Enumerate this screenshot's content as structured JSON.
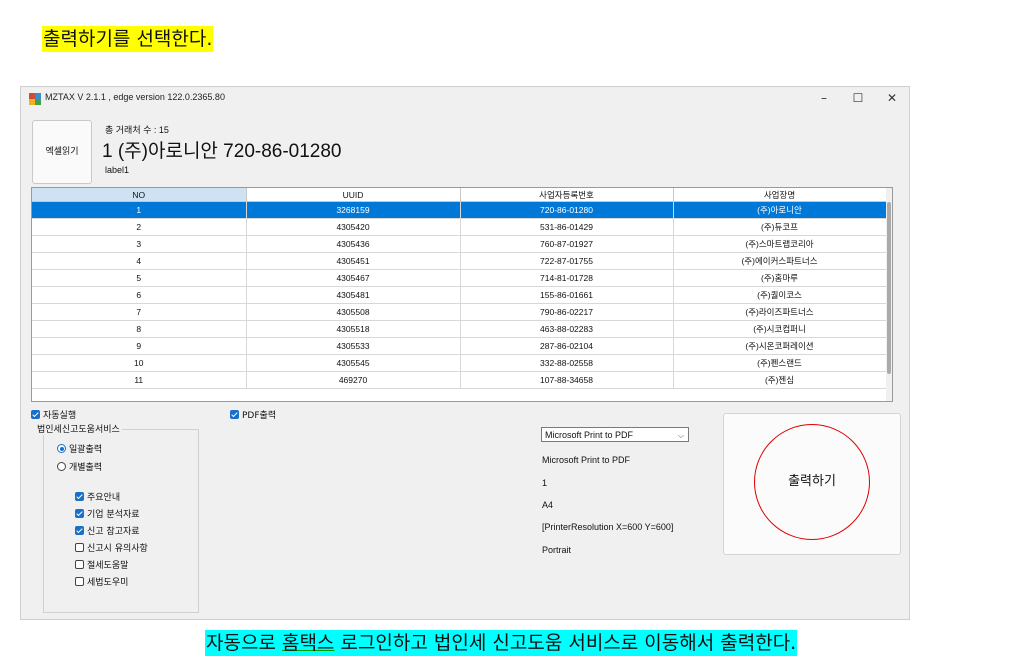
{
  "captions": {
    "top": "출력하기를 선택한다.",
    "bottom_before": "자동으로 ",
    "bottom_underlined": "홈택스",
    "bottom_after": " 로그인하고 법인세 신고도움 서비스로 이동해서 출력한다."
  },
  "window": {
    "title": "MZTAX V 2.1.1 , edge version 122.0.2365.80",
    "minimize": "–",
    "maximize": "☐",
    "close": "✕"
  },
  "header": {
    "excel_button": "엑셀읽기",
    "total_count": "총 거래처 수 : 15",
    "current_company": "1 (주)아로니안 720-86-01280",
    "label1": "label1"
  },
  "grid": {
    "columns": [
      "NO",
      "UUID",
      "사업자등록번호",
      "사업장명"
    ],
    "rows": [
      [
        "1",
        "3268159",
        "720-86-01280",
        "(주)아로니안"
      ],
      [
        "2",
        "4305420",
        "531-86-01429",
        "(주)듀코프"
      ],
      [
        "3",
        "4305436",
        "760-87-01927",
        "(주)스마트랩코리아"
      ],
      [
        "4",
        "4305451",
        "722-87-01755",
        "(주)에이커스파트너스"
      ],
      [
        "5",
        "4305467",
        "714-81-01728",
        "(주)홈마루"
      ],
      [
        "6",
        "4305481",
        "155-86-01661",
        "(주)퀄이코스"
      ],
      [
        "7",
        "4305508",
        "790-86-02217",
        "(주)라이즈파트너스"
      ],
      [
        "8",
        "4305518",
        "463-88-02283",
        "(주)시코컴퍼니"
      ],
      [
        "9",
        "4305533",
        "287-86-02104",
        "(주)시온코퍼레이션"
      ],
      [
        "10",
        "4305545",
        "332-88-02558",
        "(주)펜스랜드"
      ],
      [
        "11",
        "469270",
        "107-88-34658",
        "(주)젠심"
      ]
    ]
  },
  "options": {
    "auto_run": "자동실행",
    "pdf_output": "PDF출력",
    "group_title": "법인세신고도움서비스",
    "radio_all": "일괄출력",
    "radio_each": "개별출력",
    "items": [
      {
        "label": "주요안내",
        "checked": true
      },
      {
        "label": "기업 분석자료",
        "checked": true
      },
      {
        "label": "신고 참고자료",
        "checked": true
      },
      {
        "label": "신고시 유의사항",
        "checked": false
      },
      {
        "label": "절세도움말",
        "checked": false
      },
      {
        "label": "세법도우미",
        "checked": false
      }
    ]
  },
  "printer": {
    "selected": "Microsoft Print to PDF",
    "name": "Microsoft Print to PDF",
    "copies": "1",
    "paper": "A4",
    "resolution": "[PrinterResolution X=600 Y=600]",
    "orientation": "Portrait"
  },
  "print_button": "출력하기",
  "colors": {
    "selection": "#0078d7",
    "accent": "#1a6fc9",
    "highlight_yellow": "#ffff00",
    "highlight_cyan": "#00ffff",
    "circle": "#e00000"
  }
}
